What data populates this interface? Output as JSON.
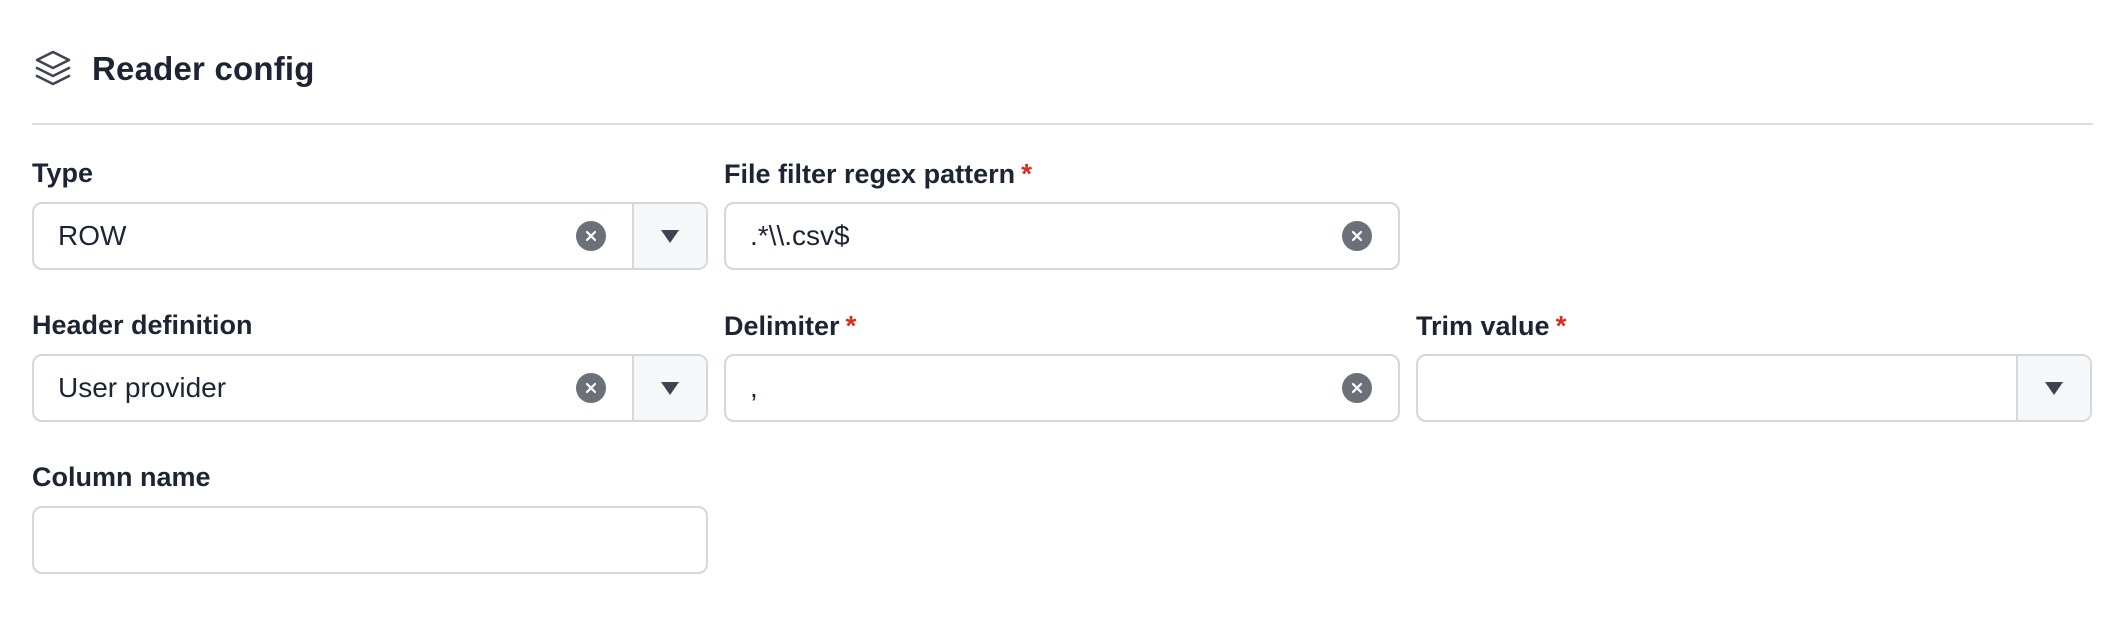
{
  "section": {
    "title": "Reader config",
    "icon": "layers-icon"
  },
  "fields": {
    "type": {
      "label": "Type",
      "value": "ROW",
      "required": false
    },
    "file_filter": {
      "label": "File filter regex pattern",
      "value": ".*\\\\.csv$",
      "required": true
    },
    "header_definition": {
      "label": "Header definition",
      "value": "User provider",
      "required": false
    },
    "delimiter": {
      "label": "Delimiter",
      "value": ",",
      "required": true
    },
    "trim_value": {
      "label": "Trim value",
      "value": "",
      "required": true
    },
    "column_name": {
      "label": "Column name",
      "value": "",
      "required": false
    }
  },
  "required_marker": "*",
  "colors": {
    "text": "#1d2433",
    "required": "#d92d20",
    "border": "#d4d7dd",
    "clear_icon_bg": "#6b7079",
    "toggle_bg": "#f6f7f9"
  }
}
